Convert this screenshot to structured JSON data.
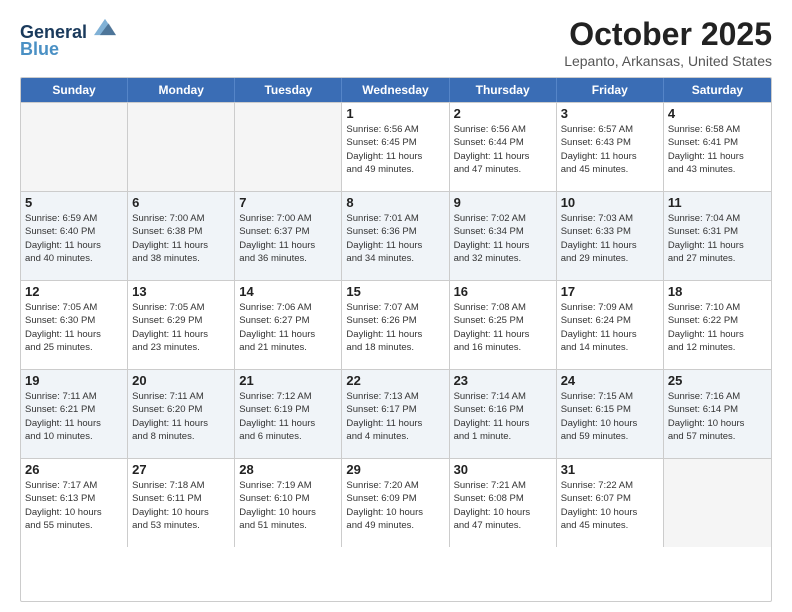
{
  "header": {
    "logo_line1": "General",
    "logo_line2": "Blue",
    "month": "October 2025",
    "location": "Lepanto, Arkansas, United States"
  },
  "weekdays": [
    "Sunday",
    "Monday",
    "Tuesday",
    "Wednesday",
    "Thursday",
    "Friday",
    "Saturday"
  ],
  "weeks": [
    [
      {
        "day": "",
        "info": ""
      },
      {
        "day": "",
        "info": ""
      },
      {
        "day": "",
        "info": ""
      },
      {
        "day": "1",
        "info": "Sunrise: 6:56 AM\nSunset: 6:45 PM\nDaylight: 11 hours\nand 49 minutes."
      },
      {
        "day": "2",
        "info": "Sunrise: 6:56 AM\nSunset: 6:44 PM\nDaylight: 11 hours\nand 47 minutes."
      },
      {
        "day": "3",
        "info": "Sunrise: 6:57 AM\nSunset: 6:43 PM\nDaylight: 11 hours\nand 45 minutes."
      },
      {
        "day": "4",
        "info": "Sunrise: 6:58 AM\nSunset: 6:41 PM\nDaylight: 11 hours\nand 43 minutes."
      }
    ],
    [
      {
        "day": "5",
        "info": "Sunrise: 6:59 AM\nSunset: 6:40 PM\nDaylight: 11 hours\nand 40 minutes."
      },
      {
        "day": "6",
        "info": "Sunrise: 7:00 AM\nSunset: 6:38 PM\nDaylight: 11 hours\nand 38 minutes."
      },
      {
        "day": "7",
        "info": "Sunrise: 7:00 AM\nSunset: 6:37 PM\nDaylight: 11 hours\nand 36 minutes."
      },
      {
        "day": "8",
        "info": "Sunrise: 7:01 AM\nSunset: 6:36 PM\nDaylight: 11 hours\nand 34 minutes."
      },
      {
        "day": "9",
        "info": "Sunrise: 7:02 AM\nSunset: 6:34 PM\nDaylight: 11 hours\nand 32 minutes."
      },
      {
        "day": "10",
        "info": "Sunrise: 7:03 AM\nSunset: 6:33 PM\nDaylight: 11 hours\nand 29 minutes."
      },
      {
        "day": "11",
        "info": "Sunrise: 7:04 AM\nSunset: 6:31 PM\nDaylight: 11 hours\nand 27 minutes."
      }
    ],
    [
      {
        "day": "12",
        "info": "Sunrise: 7:05 AM\nSunset: 6:30 PM\nDaylight: 11 hours\nand 25 minutes."
      },
      {
        "day": "13",
        "info": "Sunrise: 7:05 AM\nSunset: 6:29 PM\nDaylight: 11 hours\nand 23 minutes."
      },
      {
        "day": "14",
        "info": "Sunrise: 7:06 AM\nSunset: 6:27 PM\nDaylight: 11 hours\nand 21 minutes."
      },
      {
        "day": "15",
        "info": "Sunrise: 7:07 AM\nSunset: 6:26 PM\nDaylight: 11 hours\nand 18 minutes."
      },
      {
        "day": "16",
        "info": "Sunrise: 7:08 AM\nSunset: 6:25 PM\nDaylight: 11 hours\nand 16 minutes."
      },
      {
        "day": "17",
        "info": "Sunrise: 7:09 AM\nSunset: 6:24 PM\nDaylight: 11 hours\nand 14 minutes."
      },
      {
        "day": "18",
        "info": "Sunrise: 7:10 AM\nSunset: 6:22 PM\nDaylight: 11 hours\nand 12 minutes."
      }
    ],
    [
      {
        "day": "19",
        "info": "Sunrise: 7:11 AM\nSunset: 6:21 PM\nDaylight: 11 hours\nand 10 minutes."
      },
      {
        "day": "20",
        "info": "Sunrise: 7:11 AM\nSunset: 6:20 PM\nDaylight: 11 hours\nand 8 minutes."
      },
      {
        "day": "21",
        "info": "Sunrise: 7:12 AM\nSunset: 6:19 PM\nDaylight: 11 hours\nand 6 minutes."
      },
      {
        "day": "22",
        "info": "Sunrise: 7:13 AM\nSunset: 6:17 PM\nDaylight: 11 hours\nand 4 minutes."
      },
      {
        "day": "23",
        "info": "Sunrise: 7:14 AM\nSunset: 6:16 PM\nDaylight: 11 hours\nand 1 minute."
      },
      {
        "day": "24",
        "info": "Sunrise: 7:15 AM\nSunset: 6:15 PM\nDaylight: 10 hours\nand 59 minutes."
      },
      {
        "day": "25",
        "info": "Sunrise: 7:16 AM\nSunset: 6:14 PM\nDaylight: 10 hours\nand 57 minutes."
      }
    ],
    [
      {
        "day": "26",
        "info": "Sunrise: 7:17 AM\nSunset: 6:13 PM\nDaylight: 10 hours\nand 55 minutes."
      },
      {
        "day": "27",
        "info": "Sunrise: 7:18 AM\nSunset: 6:11 PM\nDaylight: 10 hours\nand 53 minutes."
      },
      {
        "day": "28",
        "info": "Sunrise: 7:19 AM\nSunset: 6:10 PM\nDaylight: 10 hours\nand 51 minutes."
      },
      {
        "day": "29",
        "info": "Sunrise: 7:20 AM\nSunset: 6:09 PM\nDaylight: 10 hours\nand 49 minutes."
      },
      {
        "day": "30",
        "info": "Sunrise: 7:21 AM\nSunset: 6:08 PM\nDaylight: 10 hours\nand 47 minutes."
      },
      {
        "day": "31",
        "info": "Sunrise: 7:22 AM\nSunset: 6:07 PM\nDaylight: 10 hours\nand 45 minutes."
      },
      {
        "day": "",
        "info": ""
      }
    ]
  ]
}
